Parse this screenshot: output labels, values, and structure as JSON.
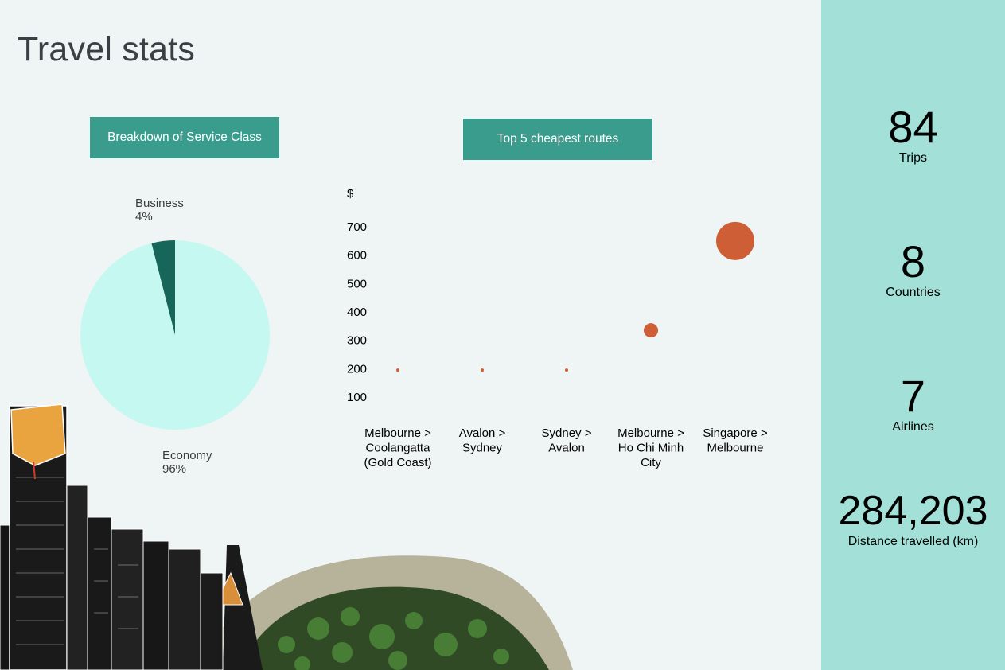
{
  "page": {
    "title": "Travel stats"
  },
  "colors": {
    "header_bg": "#3a9c8c",
    "sidebar_bg": "#a2e0d8",
    "pie_economy": "#c6f8f2",
    "pie_business": "#17665a",
    "bubble": "#cd5e35"
  },
  "pie_header": "Breakdown of Service Class",
  "scatter_header": "Top 5 cheapest routes",
  "chart_data": [
    {
      "type": "pie",
      "slices": [
        {
          "label": "Business",
          "percent_label": "4%",
          "value": 4
        },
        {
          "label": "Economy",
          "percent_label": "96%",
          "value": 96
        }
      ]
    },
    {
      "type": "scatter",
      "ylabel": "$",
      "yticks": [
        100,
        200,
        300,
        400,
        500,
        600,
        700
      ],
      "ylim": [
        100,
        700
      ],
      "grid": false,
      "categories": [
        "Melbourne > Coolangatta (Gold Coast)",
        "Avalon > Sydney",
        "Sydney > Avalon",
        "Melbourne > Ho Chi Minh City",
        "Singapore > Melbourne"
      ],
      "x_label_lines": [
        [
          "Melbourne >",
          "Coolangatta",
          "(Gold Coast)"
        ],
        [
          "Avalon >",
          "Sydney"
        ],
        [
          "Sydney >",
          "Avalon"
        ],
        [
          "Melbourne >",
          "Ho Chi Minh",
          "City"
        ],
        [
          "Singapore >",
          "Melbourne"
        ]
      ],
      "values": [
        195,
        195,
        195,
        335,
        650
      ],
      "bubble_size": [
        2,
        2,
        2,
        9,
        24
      ]
    }
  ],
  "stats": {
    "trips": {
      "value": "84",
      "label": "Trips"
    },
    "countries": {
      "value": "8",
      "label": "Countries"
    },
    "airlines": {
      "value": "7",
      "label": "Airlines"
    },
    "distance": {
      "value": "284,203",
      "label": "Distance travelled (km)"
    }
  }
}
